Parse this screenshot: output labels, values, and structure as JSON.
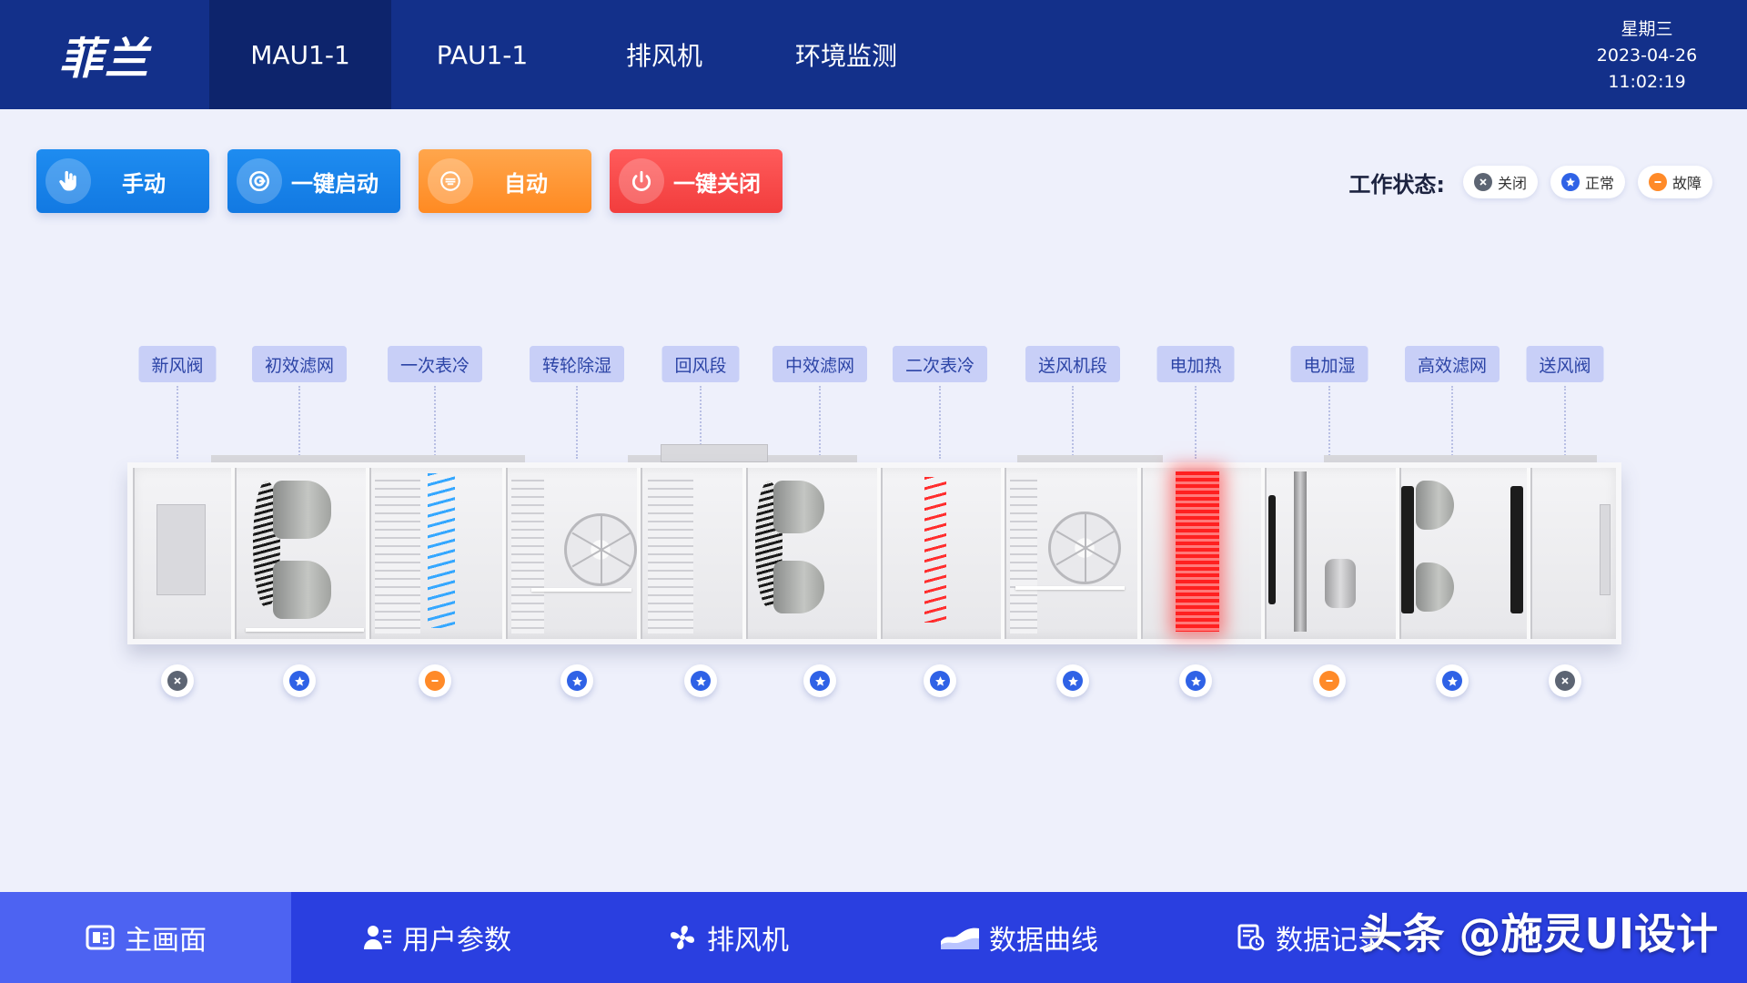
{
  "app": {
    "logo": "菲兰"
  },
  "nav": {
    "tabs": [
      {
        "label": "MAU1-1",
        "active": true
      },
      {
        "label": "PAU1-1",
        "active": false
      },
      {
        "label": "排风机",
        "active": false
      },
      {
        "label": "环境监测",
        "active": false
      }
    ]
  },
  "clock": {
    "weekday": "星期三",
    "date": "2023-04-26",
    "time": "11:02:19"
  },
  "controls": [
    {
      "label": "手动",
      "icon": "hand-icon",
      "color": "#1a85ec"
    },
    {
      "label": "一键启动",
      "icon": "power-start-icon",
      "color": "#1a85ec"
    },
    {
      "label": "自动",
      "icon": "auto-icon",
      "color": "#ff962f"
    },
    {
      "label": "一键关闭",
      "icon": "power-off-icon",
      "color": "#f54646"
    }
  ],
  "status_legend": {
    "title": "工作状态:",
    "items": [
      {
        "label": "关闭",
        "state": "off",
        "color": "#5d6573"
      },
      {
        "label": "正常",
        "state": "normal",
        "color": "#2f62e6"
      },
      {
        "label": "故障",
        "state": "fault",
        "color": "#ff8a28"
      }
    ]
  },
  "sections": [
    {
      "label": "新风阀",
      "state": "off"
    },
    {
      "label": "初效滤网",
      "state": "normal"
    },
    {
      "label": "一次表冷",
      "state": "fault"
    },
    {
      "label": "转轮除湿",
      "state": "normal"
    },
    {
      "label": "回风段",
      "state": "normal"
    },
    {
      "label": "中效滤网",
      "state": "normal"
    },
    {
      "label": "二次表冷",
      "state": "normal"
    },
    {
      "label": "送风机段",
      "state": "normal"
    },
    {
      "label": "电加热",
      "state": "normal"
    },
    {
      "label": "电加湿",
      "state": "fault"
    },
    {
      "label": "高效滤网",
      "state": "normal"
    },
    {
      "label": "送风阀",
      "state": "off"
    }
  ],
  "bottom_nav": [
    {
      "label": "主画面",
      "icon": "home-screen-icon",
      "active": true
    },
    {
      "label": "用户参数",
      "icon": "user-settings-icon",
      "active": false
    },
    {
      "label": "排风机",
      "icon": "fan-icon",
      "active": false
    },
    {
      "label": "数据曲线",
      "icon": "area-chart-icon",
      "active": false
    },
    {
      "label": "数据记录",
      "icon": "data-record-icon",
      "active": false
    }
  ],
  "watermark": "头条 @施灵UI设计"
}
